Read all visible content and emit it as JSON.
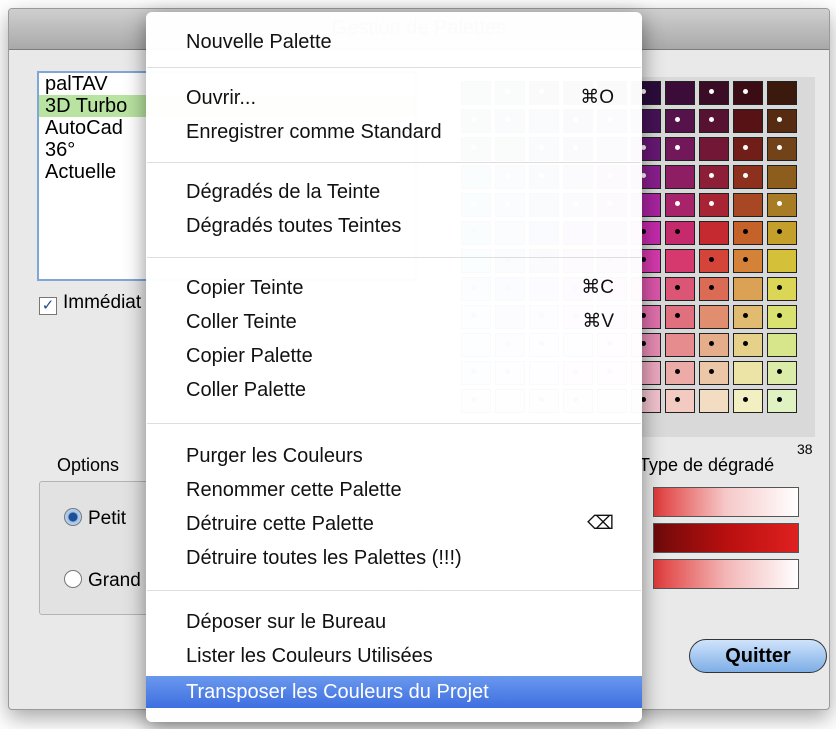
{
  "window": {
    "title": "Gestion de Palettes"
  },
  "palettes": [
    "palTAV",
    "3D Turbo",
    "AutoCad",
    "36°",
    "Actuelle"
  ],
  "palettes_selected": 1,
  "immediate_label": "Immédiat",
  "immediate_checked": true,
  "options_label": "Options",
  "size_options": [
    "Petit",
    "Grand"
  ],
  "size_selected": 0,
  "swatch_count": "38",
  "gradient_type_label": "Type de dégradé",
  "quit_label": "Quitter",
  "colors": {
    "menu_highlight": "#4a7be6",
    "selected_row": "#b8e3a0",
    "button": "#9cc2ee"
  },
  "menu": [
    {
      "label": "Nouvelle Palette",
      "shortcut": ""
    },
    {
      "label": "Ouvrir...",
      "shortcut": "⌘O"
    },
    {
      "label": "Enregistrer comme Standard",
      "shortcut": ""
    },
    {
      "label": "Dégradés de la Teinte",
      "shortcut": ""
    },
    {
      "label": "Dégradés toutes Teintes",
      "shortcut": ""
    },
    {
      "label": "Copier Teinte",
      "shortcut": "⌘C"
    },
    {
      "label": "Coller Teinte",
      "shortcut": "⌘V"
    },
    {
      "label": "Copier Palette",
      "shortcut": ""
    },
    {
      "label": "Coller Palette",
      "shortcut": ""
    },
    {
      "label": "Purger les Couleurs",
      "shortcut": ""
    },
    {
      "label": "Renommer cette Palette",
      "shortcut": ""
    },
    {
      "label": "Détruire cette Palette",
      "shortcut": "⌫"
    },
    {
      "label": "Détruire toutes les Palettes (!!!)",
      "shortcut": ""
    },
    {
      "label": "Déposer sur le Bureau",
      "shortcut": ""
    },
    {
      "label": "Lister les Couleurs Utilisées",
      "shortcut": ""
    },
    {
      "label": "Transposer les Couleurs du Projet",
      "shortcut": "",
      "highlighted": true
    }
  ]
}
